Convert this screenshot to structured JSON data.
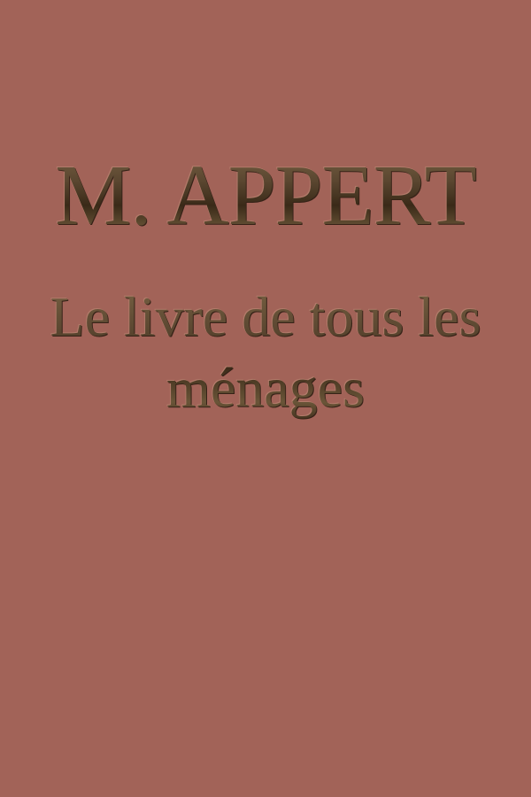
{
  "cover": {
    "author": "M. APPERT",
    "title_line_1": "Le livre de tous les",
    "title_line_2": "ménages"
  },
  "colors": {
    "background": "#a26358",
    "text": "#4e3b26"
  }
}
